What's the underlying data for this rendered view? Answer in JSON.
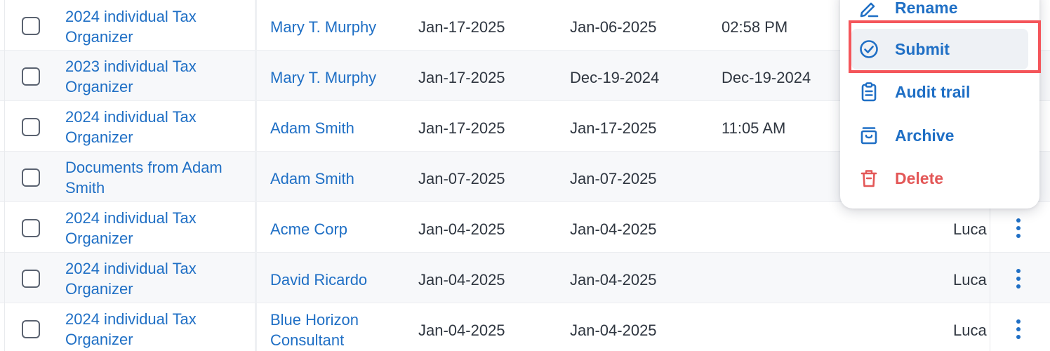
{
  "rows": [
    {
      "doc": "2024 individual Tax Organizer",
      "client": "Mary T. Murphy",
      "date1": "Jan-17-2025",
      "date2": "Jan-06-2025",
      "date3": "02:58 PM",
      "owner": ""
    },
    {
      "doc": "2023 individual Tax Organizer",
      "client": "Mary T. Murphy",
      "date1": "Jan-17-2025",
      "date2": "Dec-19-2024",
      "date3": "Dec-19-2024",
      "owner": ""
    },
    {
      "doc": "2024 individual Tax Organizer",
      "client": "Adam Smith",
      "date1": "Jan-17-2025",
      "date2": "Jan-17-2025",
      "date3": "11:05 AM",
      "owner": ""
    },
    {
      "doc": "Documents from Adam Smith",
      "client": "Adam Smith",
      "date1": "Jan-07-2025",
      "date2": "Jan-07-2025",
      "date3": "",
      "owner": ""
    },
    {
      "doc": "2024 individual Tax Organizer",
      "client": "Acme Corp",
      "date1": "Jan-04-2025",
      "date2": "Jan-04-2025",
      "date3": "",
      "owner": "Luca"
    },
    {
      "doc": "2024 individual Tax Organizer",
      "client": "David Ricardo",
      "date1": "Jan-04-2025",
      "date2": "Jan-04-2025",
      "date3": "",
      "owner": "Luca"
    },
    {
      "doc": "2024 individual Tax Organizer",
      "client": "Blue Horizon Consultant",
      "date1": "Jan-04-2025",
      "date2": "Jan-04-2025",
      "date3": "",
      "owner": "Luca"
    }
  ],
  "menu": {
    "items": [
      {
        "label": "Rename",
        "icon": "pencil-icon"
      },
      {
        "label": "Submit",
        "icon": "check-circle-icon"
      },
      {
        "label": "Audit trail",
        "icon": "clipboard-icon"
      },
      {
        "label": "Archive",
        "icon": "archive-box-icon"
      },
      {
        "label": "Delete",
        "icon": "trash-icon"
      }
    ]
  },
  "colors": {
    "link": "#1f6fc5",
    "danger": "#e35757",
    "highlight": "#f4555a",
    "alt_row": "#f7f8fa"
  }
}
